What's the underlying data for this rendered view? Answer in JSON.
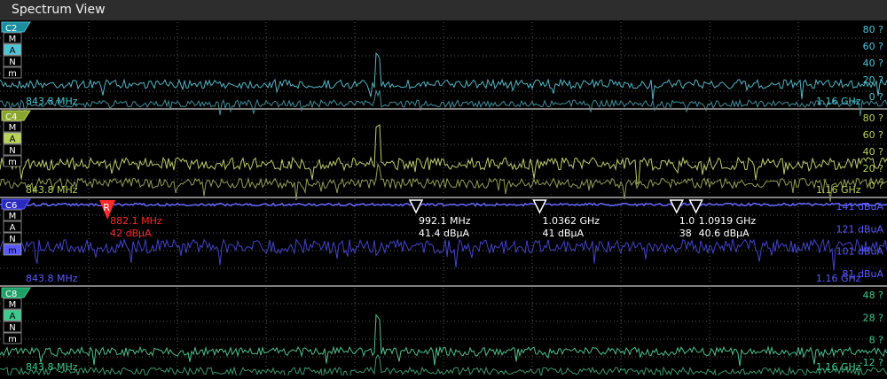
{
  "window": {
    "title": "Spectrum View"
  },
  "channels": [
    {
      "id": "C2",
      "color": "#4fc4d4",
      "trace_color": "#5ec8d8",
      "label_bg": "#1b8d9c",
      "buttons": [
        "M",
        "A",
        "N",
        "m"
      ],
      "active_buttons": [
        "A"
      ],
      "start_freq": "843.8 MHz",
      "stop_freq": "1.16 GHz",
      "scale_labels": [
        "80 ?",
        "60 ?",
        "40 ?",
        "20 ?",
        "0 ?"
      ],
      "level": 0.72,
      "noise": 0.1,
      "spike": 0.3,
      "second_trace": true
    },
    {
      "id": "C4",
      "color": "#b8d25a",
      "trace_color": "#d0e07a",
      "label_bg": "#8aa52f",
      "buttons": [
        "M",
        "A",
        "N",
        "m"
      ],
      "active_buttons": [
        "A"
      ],
      "start_freq": "843.8 MHz",
      "stop_freq": "1.16 GHz",
      "scale_labels": [
        "80 ?",
        "60 ?",
        "40 ?",
        "20 ?",
        "0 ?"
      ],
      "level": 0.62,
      "noise": 0.14,
      "spike": 0.45,
      "second_trace": true
    },
    {
      "id": "C6",
      "color": "#5a5aff",
      "trace_color": "#4a4ae0",
      "label_bg": "#2a2abf",
      "buttons": [
        "M",
        "A",
        "N",
        "m"
      ],
      "active_buttons": [
        "m"
      ],
      "start_freq": "843.8 MHz",
      "stop_freq": "1.16 GHz",
      "scale_labels": [
        "141 dBuA",
        "121 dBuA",
        "101 dBuA",
        "81 dBuA"
      ],
      "level": 0.55,
      "noise": 0.16,
      "spike": 0.0,
      "second_trace": false
    },
    {
      "id": "C8",
      "color": "#3ec98c",
      "trace_color": "#58d49a",
      "label_bg": "#1f9e66",
      "buttons": [
        "M",
        "A",
        "N",
        "m"
      ],
      "active_buttons": [
        "A"
      ],
      "start_freq": "843.8 MHz",
      "stop_freq": "1.16 GHz",
      "scale_labels": [
        "48 ?",
        "28 ?",
        "8 ?",
        "-12 ?"
      ],
      "level": 0.74,
      "noise": 0.1,
      "spike": 0.38,
      "second_trace": true
    }
  ],
  "markers": [
    {
      "label": "R",
      "reference": true,
      "freq_text": "882.1 MHz",
      "amp_text": "42 dBµA",
      "color": "#ff2a2a",
      "freq_mhz": 882.1
    },
    {
      "label": "",
      "reference": false,
      "freq_text": "992.1 MHz",
      "amp_text": "41.4 dBµA",
      "color": "#ffffff",
      "freq_mhz": 992.1
    },
    {
      "label": "",
      "reference": false,
      "freq_text": "1.0362 GHz",
      "amp_text": "41 dBµA",
      "color": "#ffffff",
      "freq_mhz": 1036.2
    },
    {
      "label": "",
      "reference": false,
      "freq_text": "1.0",
      "amp_text": "38",
      "color": "#ffffff",
      "freq_mhz": 1085.0
    },
    {
      "label": "",
      "reference": false,
      "freq_text": "1.0919 GHz",
      "amp_text": "40.6 dBµA",
      "color": "#ffffff",
      "freq_mhz": 1091.9
    }
  ]
}
